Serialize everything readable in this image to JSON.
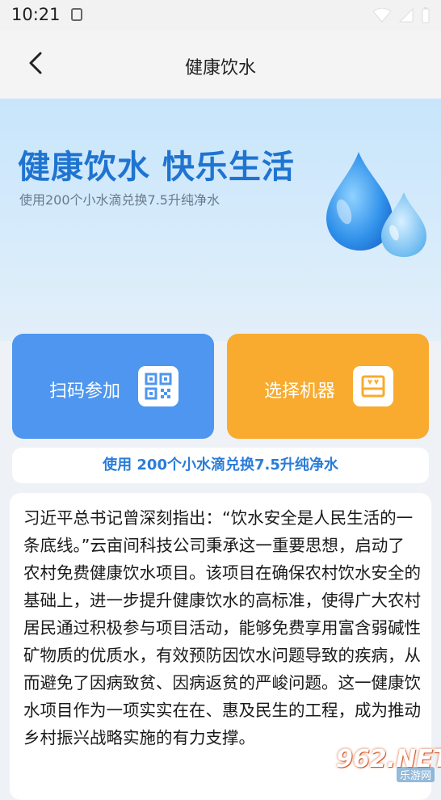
{
  "status_bar": {
    "time": "10:21"
  },
  "nav": {
    "title": "健康饮水"
  },
  "hero": {
    "title": "健康饮水 快乐生活",
    "subtitle": "使用200个小水滴兑换7.5升纯净水"
  },
  "actions": {
    "scan_label": "扫码参加",
    "machine_label": "选择机器"
  },
  "banner": {
    "text": "使用 200个小水滴兑换7.5升纯净水"
  },
  "article": {
    "text": "习近平总书记曾深刻指出：“饮水安全是人民生活的一条底线。”云亩间科技公司秉承这一重要思想，启动了农村免费健康饮水项目。该项目在确保农村饮水安全的基础上，进一步提升健康饮水的高标准，使得广大农村居民通过积极参与项目活动，能够免费享用富含弱碱性矿物质的优质水，有效预防因饮水问题导致的疾病，从而避免了因病致贫、因病返贫的严峻问题。这一健康饮水项目作为一项实实在在、惠及民生的工程，成为推动乡村振兴战略实施的有力支撑。"
  },
  "watermark": {
    "main": "962.NET",
    "sub": "乐游网"
  },
  "colors": {
    "accent": "#1f74d1",
    "scan_card": "#4e96ef",
    "machine_card": "#f8ab2e"
  }
}
